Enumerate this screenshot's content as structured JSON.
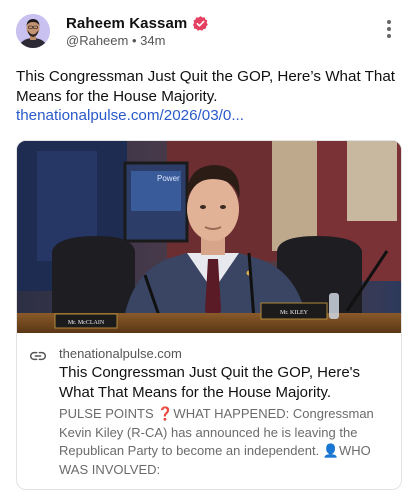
{
  "author": {
    "name": "Raheem Kassam",
    "handle": "@Raheem",
    "separator": "•",
    "time": "34m",
    "verified_color": "#e4405f"
  },
  "post": {
    "text": "This Congressman Just Quit the GOP, Here’s What That Means for the House Majority.",
    "link": "thenationalpulse.com/2026/03/0..."
  },
  "card": {
    "domain": "thenationalpulse.com",
    "title": "This Congressman Just Quit the GOP, Here's What That Means for the House Majority.",
    "description": "PULSE POINTS ❓WHAT HAPPENED: Congressman Kevin Kiley (R-CA) has announced he is leaving the Republican Party to become an independent. 👤WHO WAS INVOLVED:",
    "image": {
      "placard_left": "Mr. McCLAIN",
      "placard_right": "Mr. KILEY",
      "screen_text": "Power"
    }
  },
  "icons": {
    "more": "more-vertical-icon",
    "verified": "verified-badge-icon",
    "link": "link-icon"
  },
  "colors": {
    "link": "#2a5ac9",
    "muted": "#6b6b6b"
  }
}
